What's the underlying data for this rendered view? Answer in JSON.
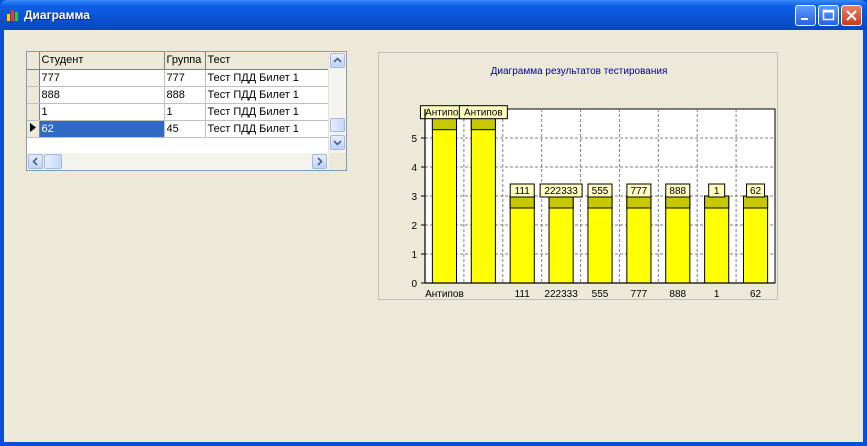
{
  "window": {
    "title": "Диаграмма"
  },
  "grid": {
    "columns": [
      "Студент",
      "Группа",
      "Тест"
    ],
    "rows": [
      [
        "777",
        "777",
        "Тест ПДД Билет 1"
      ],
      [
        "888",
        "888",
        "Тест ПДД Билет 1"
      ],
      [
        "1",
        "1",
        "Тест ПДД Билет 1"
      ],
      [
        "62",
        "45",
        "Тест ПДД Билет 1"
      ]
    ],
    "selected_row": 3
  },
  "chart_data": {
    "type": "bar",
    "title": "Диаграмма результатов тестирования",
    "categories": [
      "Антипов",
      "Антипов",
      "111",
      "222333",
      "555",
      "777",
      "888",
      "1",
      "62"
    ],
    "tick_labels": [
      "Антипов",
      "",
      "111",
      "222333",
      "555",
      "777",
      "888",
      "1",
      "62"
    ],
    "values": [
      5.7,
      5.7,
      3,
      3,
      3,
      3,
      3,
      3,
      3
    ],
    "data_labels": [
      "Антипов",
      "Антипов",
      "111",
      "222333",
      "555",
      "777",
      "888",
      "1",
      "62"
    ],
    "ylim": [
      0,
      6
    ],
    "yticks": [
      0,
      1,
      2,
      3,
      4,
      5
    ],
    "grid": true,
    "colors": {
      "bar": "#ffff00",
      "bar_top": "#c8c800",
      "label_bg": "#ffffc0"
    }
  }
}
